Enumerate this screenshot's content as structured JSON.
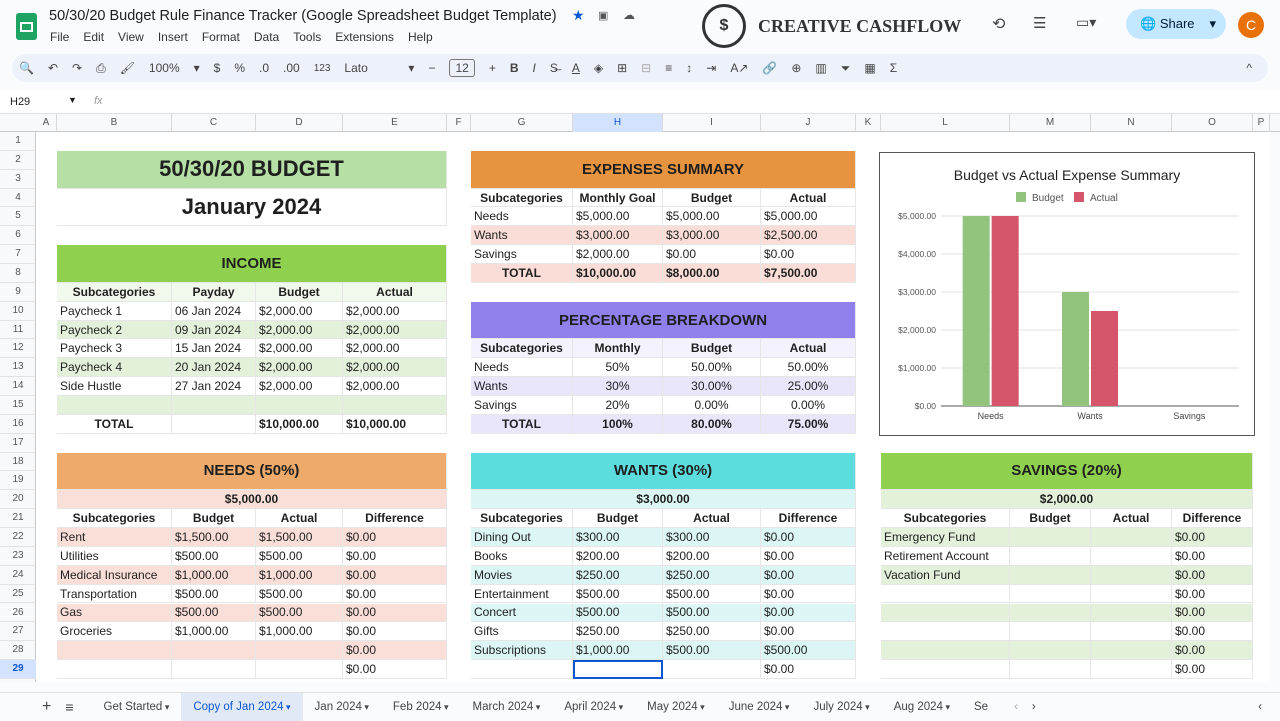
{
  "app": {
    "title": "50/30/20 Budget Rule Finance Tracker (Google Spreadsheet Budget Template)",
    "menu": [
      "File",
      "Edit",
      "View",
      "Insert",
      "Format",
      "Data",
      "Tools",
      "Extensions",
      "Help"
    ],
    "brand": "CREATIVE CASHFLOW",
    "share": "Share",
    "avatar": "C"
  },
  "toolbar": {
    "zoom": "100%",
    "currency": "$",
    "percent": "%",
    "dec_less": ".0",
    "dec_more": ".00",
    "format": "123",
    "font": "Lato",
    "font_size": "12",
    "bold": "B",
    "italic": "I"
  },
  "formula_bar": {
    "cell_ref": "H29",
    "fx": "fx",
    "value": ""
  },
  "columns": [
    "A",
    "B",
    "C",
    "D",
    "E",
    "F",
    "G",
    "H",
    "I",
    "J",
    "K",
    "L",
    "M",
    "N",
    "O",
    "P"
  ],
  "selected_cell": {
    "col": "H",
    "row": 29
  },
  "budget": {
    "title": "50/30/20 BUDGET",
    "month": "January 2024"
  },
  "income": {
    "title": "INCOME",
    "headers": [
      "Subcategories",
      "Payday",
      "Budget",
      "Actual"
    ],
    "rows": [
      [
        "Paycheck 1",
        "06 Jan 2024",
        "$2,000.00",
        "$2,000.00"
      ],
      [
        "Paycheck 2",
        "09 Jan 2024",
        "$2,000.00",
        "$2,000.00"
      ],
      [
        "Paycheck 3",
        "15 Jan 2024",
        "$2,000.00",
        "$2,000.00"
      ],
      [
        "Paycheck 4",
        "20 Jan 2024",
        "$2,000.00",
        "$2,000.00"
      ],
      [
        "Side Hustle",
        "27 Jan 2024",
        "$2,000.00",
        "$2,000.00"
      ],
      [
        "",
        "",
        "",
        ""
      ]
    ],
    "total": [
      "TOTAL",
      "",
      "$10,000.00",
      "$10,000.00"
    ]
  },
  "expenses_summary": {
    "title": "EXPENSES SUMMARY",
    "headers": [
      "Subcategories",
      "Monthly Goal",
      "Budget",
      "Actual"
    ],
    "rows": [
      [
        "Needs",
        "$5,000.00",
        "$5,000.00",
        "$5,000.00"
      ],
      [
        "Wants",
        "$3,000.00",
        "$3,000.00",
        "$2,500.00"
      ],
      [
        "Savings",
        "$2,000.00",
        "$0.00",
        "$0.00"
      ]
    ],
    "total": [
      "TOTAL",
      "$10,000.00",
      "$8,000.00",
      "$7,500.00"
    ]
  },
  "percentage_breakdown": {
    "title": "PERCENTAGE BREAKDOWN",
    "headers": [
      "Subcategories",
      "Monthly",
      "Budget",
      "Actual"
    ],
    "rows": [
      [
        "Needs",
        "50%",
        "50.00%",
        "50.00%"
      ],
      [
        "Wants",
        "30%",
        "30.00%",
        "25.00%"
      ],
      [
        "Savings",
        "20%",
        "0.00%",
        "0.00%"
      ]
    ],
    "total": [
      "TOTAL",
      "100%",
      "80.00%",
      "75.00%"
    ]
  },
  "needs": {
    "title": "NEEDS (50%)",
    "amount": "$5,000.00",
    "headers": [
      "Subcategories",
      "Budget",
      "Actual",
      "Difference"
    ],
    "rows": [
      [
        "Rent",
        "$1,500.00",
        "$1,500.00",
        "$0.00"
      ],
      [
        "Utilities",
        "$500.00",
        "$500.00",
        "$0.00"
      ],
      [
        "Medical Insurance",
        "$1,000.00",
        "$1,000.00",
        "$0.00"
      ],
      [
        "Transportation",
        "$500.00",
        "$500.00",
        "$0.00"
      ],
      [
        "Gas",
        "$500.00",
        "$500.00",
        "$0.00"
      ],
      [
        "Groceries",
        "$1,000.00",
        "$1,000.00",
        "$0.00"
      ],
      [
        "",
        "",
        "",
        "$0.00"
      ],
      [
        "",
        "",
        "",
        "$0.00"
      ]
    ]
  },
  "wants": {
    "title": "WANTS (30%)",
    "amount": "$3,000.00",
    "headers": [
      "Subcategories",
      "Budget",
      "Actual",
      "Difference"
    ],
    "rows": [
      [
        "Dining Out",
        "$300.00",
        "$300.00",
        "$0.00"
      ],
      [
        "Books",
        "$200.00",
        "$200.00",
        "$0.00"
      ],
      [
        "Movies",
        "$250.00",
        "$250.00",
        "$0.00"
      ],
      [
        "Entertainment",
        "$500.00",
        "$500.00",
        "$0.00"
      ],
      [
        "Concert",
        "$500.00",
        "$500.00",
        "$0.00"
      ],
      [
        "Gifts",
        "$250.00",
        "$250.00",
        "$0.00"
      ],
      [
        "Subscriptions",
        "$1,000.00",
        "$500.00",
        "$500.00"
      ],
      [
        "",
        "",
        "",
        "$0.00"
      ]
    ]
  },
  "savings": {
    "title": "SAVINGS (20%)",
    "amount": "$2,000.00",
    "headers": [
      "Subcategories",
      "Budget",
      "Actual",
      "Difference"
    ],
    "rows": [
      [
        "Emergency Fund",
        "",
        "",
        "$0.00"
      ],
      [
        "Retirement Account",
        "",
        "",
        "$0.00"
      ],
      [
        "Vacation Fund",
        "",
        "",
        "$0.00"
      ],
      [
        "",
        "",
        "",
        "$0.00"
      ],
      [
        "",
        "",
        "",
        "$0.00"
      ],
      [
        "",
        "",
        "",
        "$0.00"
      ],
      [
        "",
        "",
        "",
        "$0.00"
      ],
      [
        "",
        "",
        "",
        "$0.00"
      ]
    ]
  },
  "colors": {
    "budget_title": "#b6dfa5",
    "income_title": "#8fd14f",
    "income_alt": "#e4f1da",
    "expenses_title": "#e69440",
    "expenses_alt": "#f9ddd6",
    "percent_title": "#8f80ec",
    "percent_alt": "#e9e5fb",
    "needs_title": "#eeaa6b",
    "needs_alt": "#fadfd8",
    "wants_title": "#5cdcdc",
    "wants_alt": "#dcf5f5",
    "savings_title": "#8fd14f",
    "savings_alt": "#e4f1da",
    "accent": "#0b57d0"
  },
  "chart_data": {
    "type": "bar",
    "title": "Budget vs Actual Expense Summary",
    "categories": [
      "Needs",
      "Wants",
      "Savings"
    ],
    "series": [
      {
        "name": "Budget",
        "color": "#93c47d",
        "values": [
          5000,
          3000,
          0
        ]
      },
      {
        "name": "Actual",
        "color": "#d5556a",
        "values": [
          5000,
          2500,
          0
        ]
      }
    ],
    "yticks": [
      "$0.00",
      "$1,000.00",
      "$2,000.00",
      "$3,000.00",
      "$4,000.00",
      "$5,000.00"
    ],
    "ylim": [
      0,
      5000
    ],
    "grid": true,
    "legend": "top"
  },
  "sheets": {
    "tabs": [
      "Get Started",
      "Copy of Jan 2024",
      "Jan 2024",
      "Feb 2024",
      "March 2024",
      "April 2024",
      "May 2024",
      "June 2024",
      "July 2024",
      "Aug 2024",
      "Se"
    ],
    "active": 1
  }
}
